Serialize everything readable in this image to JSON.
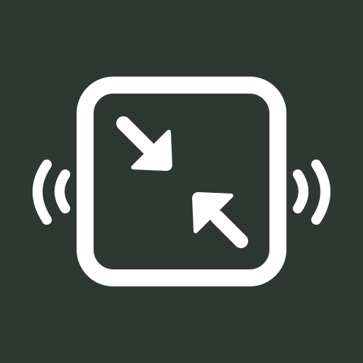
{
  "colors": {
    "background": "#2d3833",
    "foreground": "#ffffff"
  },
  "icon": {
    "name": "shrink-vibrate-icon",
    "parts": [
      "rounded-square-frame",
      "inward-arrows",
      "vibration-waves"
    ]
  }
}
